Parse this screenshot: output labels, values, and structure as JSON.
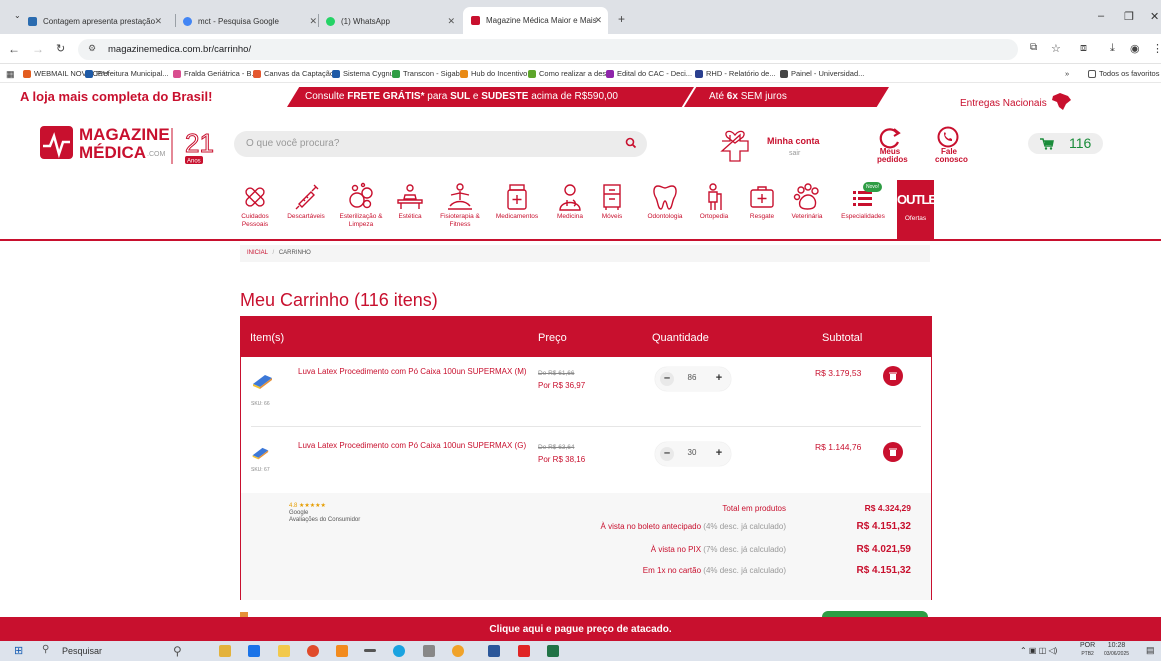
{
  "browser": {
    "tabs": [
      {
        "title": "Contagem apresenta prestação",
        "icon": "bookmark-flag-icon",
        "color": "#2b6cb0"
      },
      {
        "title": "mct - Pesquisa Google",
        "icon": "google-icon",
        "color": "#4285f4"
      },
      {
        "title": "(1) WhatsApp",
        "icon": "whatsapp-icon",
        "color": "#25d366"
      },
      {
        "title": "Magazine Médica Maior e Mais",
        "icon": "magazine-medica-icon",
        "color": "#c8102e"
      }
    ],
    "new_tab": "+",
    "url": "magazinemedica.com.br/carrinho/",
    "bookmarks": [
      "WEBMAIL NOVOCEU",
      "Prefeitura Municipal...",
      "Fralda Geriátrica - B...",
      "Canvas da Captação...",
      "Sistema Cygnus",
      "Transcon - Sigabus",
      "Hub do Incentivo",
      "Como realizar a des...",
      "Edital do CAC - Deci...",
      "RHD - Relatório de...",
      "Painel - Universidad..."
    ],
    "bookmarks_more": "»",
    "all_bookmarks": "Todos os favoritos"
  },
  "site": {
    "slogan": "A loja mais completa do Brasil!",
    "promo_free_shipping": {
      "prefix": "Consulte ",
      "bold1": "FRETE GRÁTIS*",
      "mid": " para ",
      "bold2": "SUL",
      "and": " e ",
      "bold3": "SUDESTE",
      "suffix": " acima de R$590,00"
    },
    "promo_installments": {
      "prefix": "Até ",
      "bold": "6x",
      "suffix": " SEM juros"
    },
    "national_delivery": "Entregas Nacionais",
    "logo_line1": "MAGAZINE",
    "logo_line2": "MÉDICA",
    "logo_com": ".COM",
    "logo_years": "21",
    "logo_anos": "Anos",
    "search_placeholder": "O que você procura?",
    "account_label": "Minha conta",
    "account_sub": "sair",
    "orders_label1": "Meus",
    "orders_label2": "pedidos",
    "contact_label1": "Fale",
    "contact_label2": "conosco",
    "cart_count": "116",
    "brand_color": "#c8102e"
  },
  "categories": [
    {
      "label": "Cuidados Pessoais",
      "icon": "bandage-icon"
    },
    {
      "label": "Descartáveis",
      "icon": "syringe-icon"
    },
    {
      "label": "Esterilização & Limpeza",
      "icon": "bubbles-icon"
    },
    {
      "label": "Estética",
      "icon": "massage-table-icon"
    },
    {
      "label": "Fisioterapia & Fitness",
      "icon": "meditation-icon"
    },
    {
      "label": "Medicamentos",
      "icon": "medicine-jar-icon"
    },
    {
      "label": "Medicina",
      "icon": "doctor-icon"
    },
    {
      "label": "Móveis",
      "icon": "hospital-cabinet-icon"
    },
    {
      "label": "Odontologia",
      "icon": "tooth-icon"
    },
    {
      "label": "Ortopedia",
      "icon": "crutch-icon"
    },
    {
      "label": "Resgate",
      "icon": "first-aid-kit-icon"
    },
    {
      "label": "Veterinária",
      "icon": "paw-icon"
    },
    {
      "label": "Especialidades",
      "icon": "list-icon",
      "badge": "Novo!"
    },
    {
      "label": "Ofertas",
      "icon": "outlet-icon",
      "tag": "OUTLET"
    }
  ],
  "breadcrumb": {
    "home": "INICIAL",
    "sep": "/",
    "current": "CARRINHO"
  },
  "cart": {
    "title": "Meu Carrinho (116 itens)",
    "headers": {
      "item": "Item(s)",
      "price": "Preço",
      "qty": "Quantidade",
      "subtotal": "Subtotal"
    },
    "items": [
      {
        "name": "Luva Latex Procedimento com Pó Caixa 100un SUPERMAX (M)",
        "sku": "SKU: 66",
        "old_price": "De R$ 61,66",
        "new_price": "Por R$ 36,97",
        "qty": "86",
        "subtotal": "R$ 3.179,53"
      },
      {
        "name": "Luva Latex Procedimento com Pó Caixa 100un SUPERMAX (G)",
        "sku": "SKU: 67",
        "old_price": "De R$ 63,64",
        "new_price": "Por R$ 38,16",
        "qty": "30",
        "subtotal": "R$ 1.144,76"
      }
    ],
    "rating": {
      "score": "4.8",
      "stars": "★★★★★",
      "source": "Google",
      "caption": "Avaliações do Consumidor"
    },
    "totals": [
      {
        "label": "Total em produtos",
        "note": "",
        "value": "R$ 4.324,29"
      },
      {
        "label": "À vista no boleto antecipado",
        "note": "(4% desc. já calculado)",
        "value": "R$ 4.151,32"
      },
      {
        "label": "À vista no PIX",
        "note": "(7% desc. já calculado)",
        "value": "R$ 4.021,59"
      },
      {
        "label": "Em 1x no cartão",
        "note": "(4% desc. já calculado)",
        "value": "R$ 4.151,32"
      }
    ]
  },
  "bottom_banner": "Clique aqui e pague preço de atacado.",
  "taskbar": {
    "search": "Pesquisar",
    "lang": "POR",
    "lang2": "PTB2",
    "time": "10:28",
    "date": "03/06/2025"
  }
}
